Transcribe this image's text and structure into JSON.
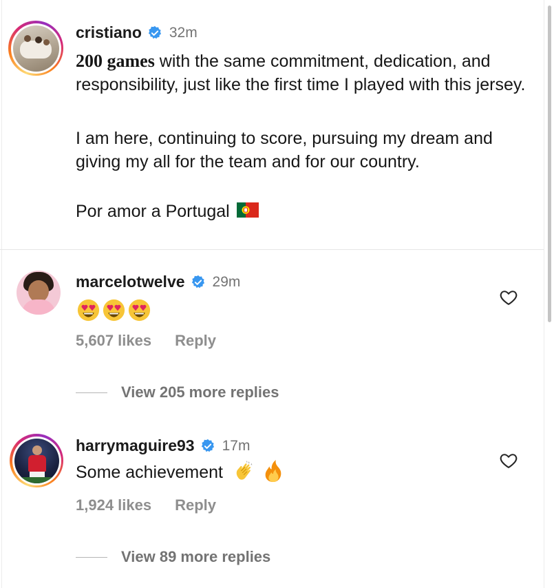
{
  "post": {
    "username": "cristiano",
    "time": "32m",
    "caption_bold": "200 games",
    "caption_rest": " with the same commitment, dedication, and responsibility, just like the first time I played with this jersey.",
    "caption_line2": "I am here, continuing to score, pursuing my dream and giving my all for the team and for our country.",
    "caption_line3": "Por amor a Portugal"
  },
  "comments": [
    {
      "username": "marcelotwelve",
      "time": "29m",
      "emoji": "heart-eyes x3",
      "likes": "5,607 likes",
      "reply_label": "Reply",
      "view_replies": "View 205 more replies"
    },
    {
      "username": "harrymaguire93",
      "time": "17m",
      "text": "Some achievement",
      "likes": "1,924 likes",
      "reply_label": "Reply",
      "view_replies": "View 89 more replies"
    }
  ],
  "colors": {
    "verified": "#3897f0",
    "muted": "#8e8e8e",
    "text": "#161616"
  }
}
